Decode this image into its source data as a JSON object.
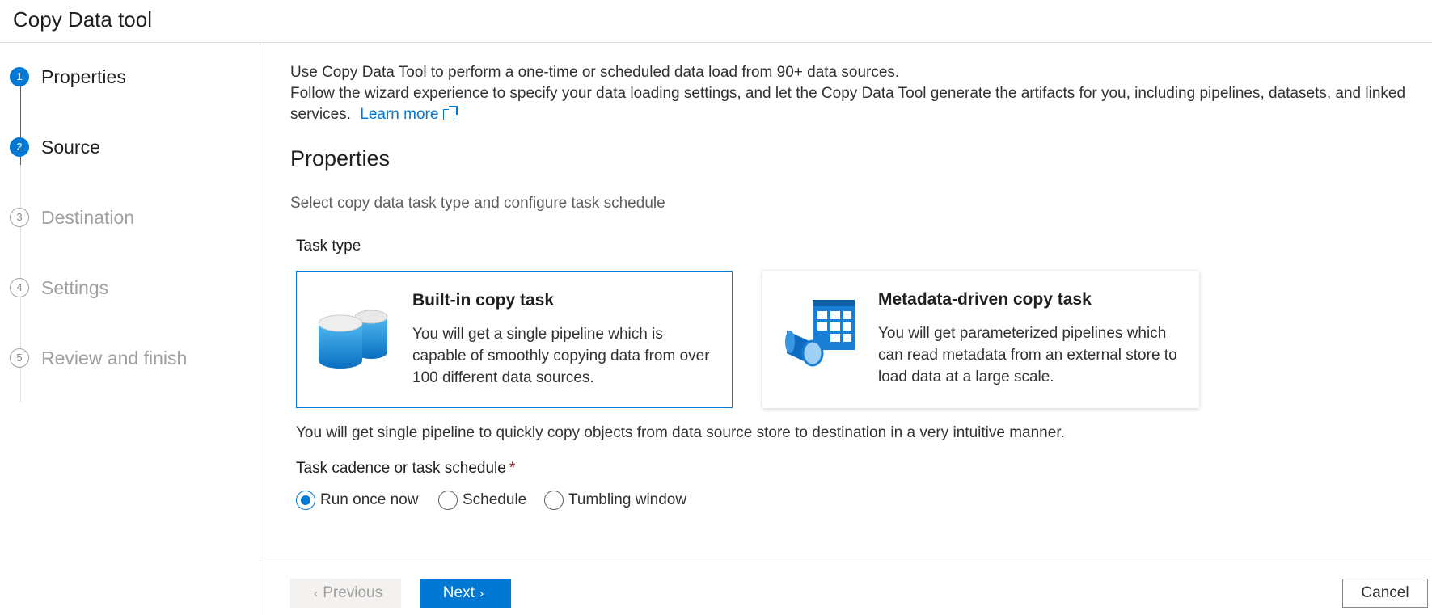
{
  "app": {
    "title": "Copy Data tool"
  },
  "steps": [
    {
      "number": "1",
      "label": "Properties"
    },
    {
      "number": "2",
      "label": "Source"
    },
    {
      "number": "3",
      "label": "Destination"
    },
    {
      "number": "4",
      "label": "Settings"
    },
    {
      "number": "5",
      "label": "Review and finish"
    }
  ],
  "intro": {
    "line1": "Use Copy Data Tool to perform a one-time or scheduled data load from 90+ data sources.",
    "line2": "Follow the wizard experience to specify your data loading settings, and let the Copy Data Tool generate the artifacts for you, including pipelines, datasets, and linked services.",
    "learn_more": "Learn more"
  },
  "section": {
    "title": "Properties",
    "description": "Select copy data task type and configure task schedule"
  },
  "task_type": {
    "label": "Task type",
    "cards": [
      {
        "title": "Built-in copy task",
        "description": "You will get a single pipeline which is capable of smoothly copying data from over 100 different data sources.",
        "icon": "database-icon",
        "selected": true
      },
      {
        "title": "Metadata-driven copy task",
        "description": "You will get parameterized pipelines which can read metadata from an external store to load data at a large scale.",
        "icon": "metadata-pipeline-icon",
        "selected": false
      }
    ],
    "note": "You will get single pipeline to quickly copy objects from data source store to destination in a very intuitive manner."
  },
  "cadence": {
    "label": "Task cadence or task schedule",
    "required_marker": "*",
    "options": [
      "Run once now",
      "Schedule",
      "Tumbling window"
    ],
    "selected": "Run once now"
  },
  "footer": {
    "previous": "Previous",
    "next": "Next",
    "cancel": "Cancel"
  },
  "colors": {
    "accent": "#0078d4",
    "required": "#a4262c",
    "disabled": "#a19f9d"
  }
}
